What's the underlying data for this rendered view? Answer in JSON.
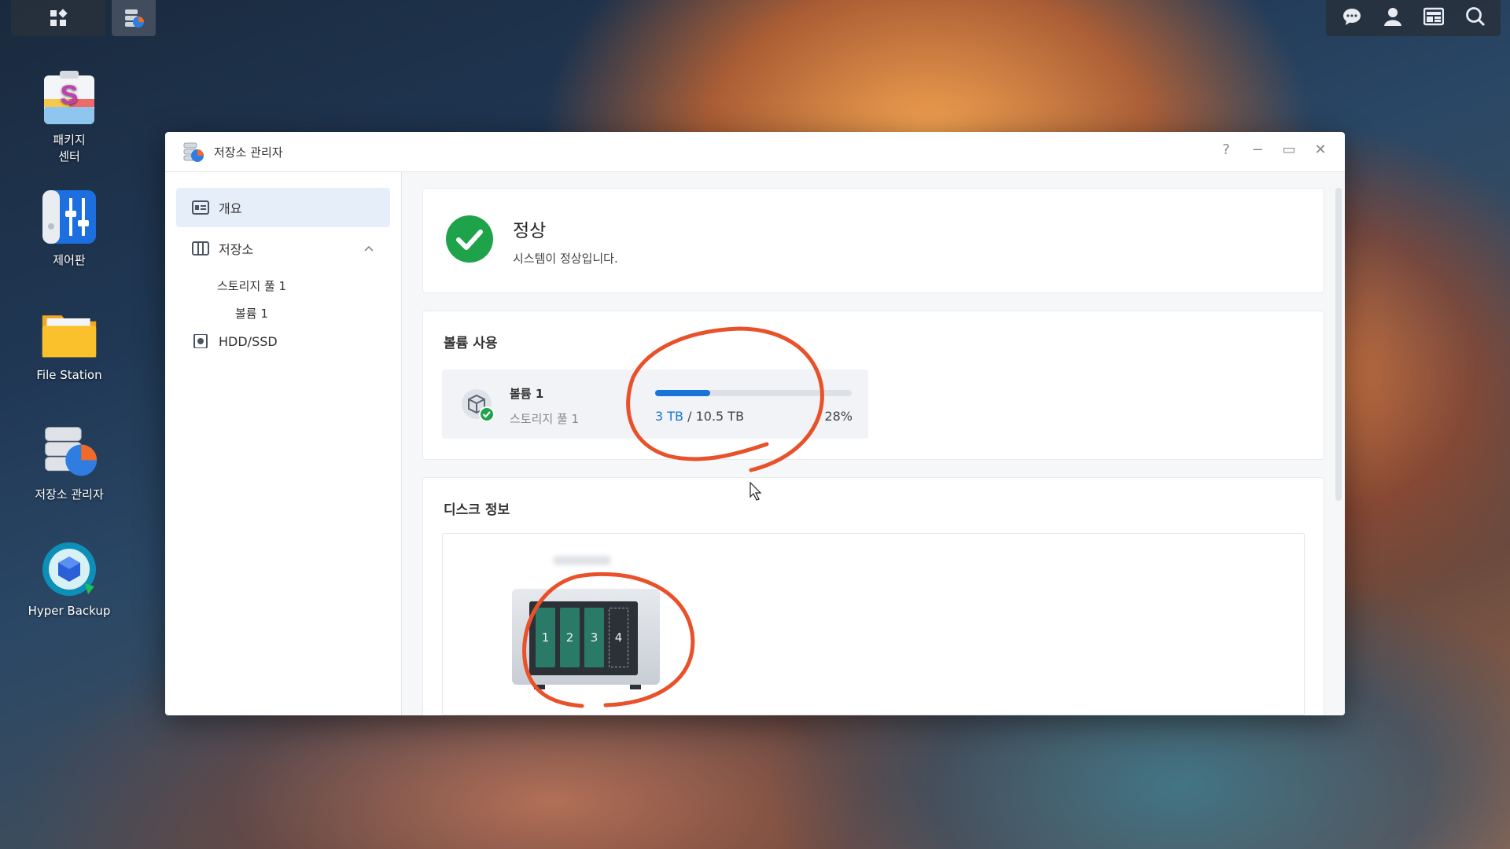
{
  "desktop": {
    "icons": [
      {
        "label": "패키지\n센터"
      },
      {
        "label": "제어판"
      },
      {
        "label": "File Station"
      },
      {
        "label": "저장소 관리자"
      },
      {
        "label": "Hyper Backup"
      }
    ]
  },
  "window": {
    "title": "저장소 관리자",
    "controls": {
      "help": "?",
      "minimize": "−",
      "maximize": "▭",
      "close": "✕"
    }
  },
  "sidebar": {
    "overview": "개요",
    "storage": "저장소",
    "storage_pool": "스토리지 풀 1",
    "volume": "볼륨 1",
    "hdd": "HDD/SSD"
  },
  "status": {
    "title": "정상",
    "message": "시스템이 정상입니다."
  },
  "volume_usage": {
    "heading": "볼륨 사용",
    "volume_name": "볼륨 1",
    "pool_name": "스토리지 풀 1",
    "used": "3 TB",
    "separator": " / ",
    "total": "10.5 TB",
    "percent": "28%",
    "percent_value": 28
  },
  "disk_info": {
    "heading": "디스크 정보",
    "bays": [
      "1",
      "2",
      "3",
      "4"
    ]
  },
  "colors": {
    "accent": "#1a73d9",
    "ok_green": "#1fa34a",
    "annotation": "#e8512a",
    "bay_green": "#2a7a68"
  }
}
